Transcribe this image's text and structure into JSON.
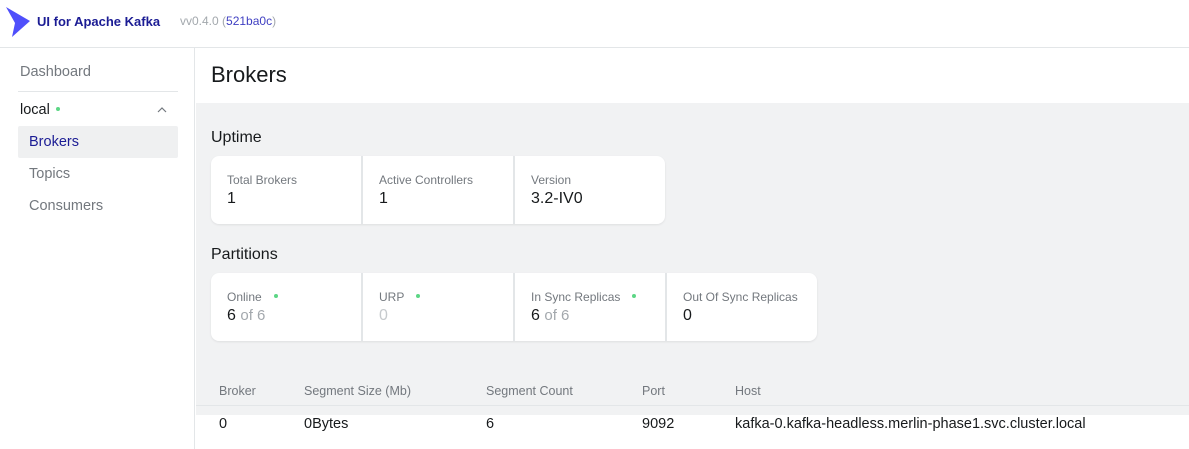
{
  "header": {
    "brand": "UI for Apache Kafka",
    "version_prefix": "vv0.4.0 (",
    "commit": "521ba0c",
    "version_suffix": ")"
  },
  "sidebar": {
    "dashboard": "Dashboard",
    "cluster": {
      "name": "local",
      "status": "online"
    },
    "items": [
      {
        "label": "Brokers",
        "active": true
      },
      {
        "label": "Topics",
        "active": false
      },
      {
        "label": "Consumers",
        "active": false
      }
    ]
  },
  "main": {
    "title": "Brokers",
    "uptime": {
      "title": "Uptime",
      "cards": [
        {
          "label": "Total Brokers",
          "value": "1"
        },
        {
          "label": "Active Controllers",
          "value": "1"
        },
        {
          "label": "Version",
          "value": "3.2-IV0"
        }
      ]
    },
    "partitions": {
      "title": "Partitions",
      "cards": [
        {
          "label": "Online",
          "value": "6",
          "of": "of 6"
        },
        {
          "label": "URP",
          "value": "0"
        },
        {
          "label": "In Sync Replicas",
          "value": "6",
          "of": "of 6"
        },
        {
          "label": "Out Of Sync Replicas",
          "value": "0"
        }
      ]
    },
    "table": {
      "columns": [
        "Broker",
        "Segment Size (Mb)",
        "Segment Count",
        "Port",
        "Host"
      ],
      "rows": [
        [
          "0",
          "0Bytes",
          "6",
          "9092",
          "kafka-0.kafka-headless.merlin-phase1.svc.cluster.local"
        ]
      ]
    }
  },
  "colors": {
    "brand": "#1b1c94",
    "accent": "#4f4ffb",
    "status_ok": "#5cd685"
  }
}
